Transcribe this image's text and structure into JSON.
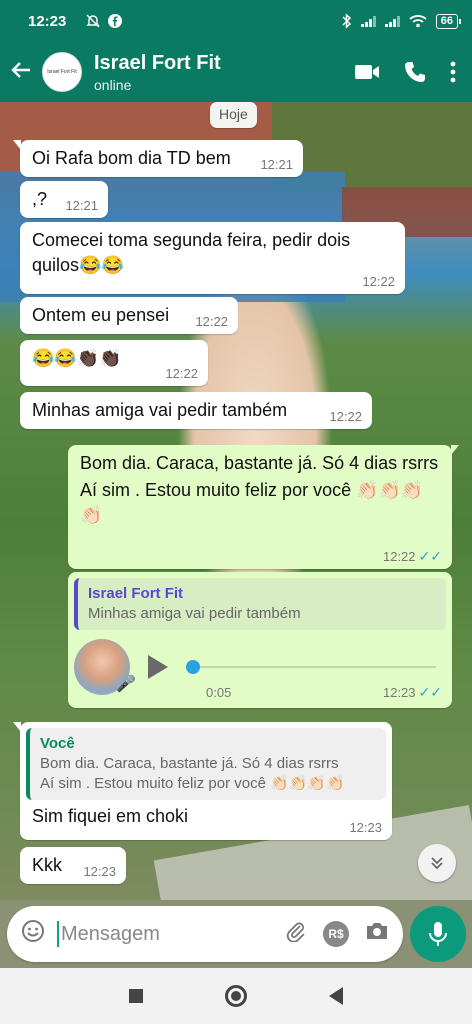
{
  "status_bar": {
    "time": "12:23",
    "battery": "66"
  },
  "header": {
    "contact_name": "Israel Fort Fit",
    "status": "online",
    "avatar_text": "Israel Fort Fit"
  },
  "chat": {
    "date_label": "Hoje",
    "messages": [
      {
        "direction": "in",
        "text": "Oi Rafa bom dia TD bem",
        "time": "12:21"
      },
      {
        "direction": "in",
        "text": ",?",
        "time": "12:21"
      },
      {
        "direction": "in",
        "text": "Comecei toma segunda feira, pedir dois quilos😂😂",
        "time": "12:22"
      },
      {
        "direction": "in",
        "text": "Ontem eu pensei",
        "time": "12:22"
      },
      {
        "direction": "in",
        "text": "😂😂👏🏿👏🏿",
        "time": "12:22"
      },
      {
        "direction": "in",
        "text": "Minhas amiga vai pedir também",
        "time": "12:22"
      },
      {
        "direction": "out",
        "text_line1": "Bom dia. Caraca, bastante já.  Só 4 dias rsrrs",
        "text_line2": "Aí sim . Estou muito feliz por você 👏🏻👏🏻👏🏻👏🏻",
        "time": "12:22",
        "read": true
      },
      {
        "direction": "out",
        "type": "voice",
        "quote_name": "Israel Fort Fit",
        "quote_text": "Minhas amiga vai pedir também",
        "duration": "0:05",
        "progress": 0,
        "time": "12:23",
        "read": true
      },
      {
        "direction": "in",
        "quote_name": "Você",
        "quote_line1": "Bom dia. Caraca, bastante já.  Só 4 dias rsrrs",
        "quote_line2": "Aí sim . Estou muito feliz por você 👏🏻👏🏻👏🏻👏🏻",
        "text": "Sim fiquei em choki",
        "time": "12:23"
      },
      {
        "direction": "in",
        "text": "Kkk",
        "time": "12:23"
      }
    ]
  },
  "composer": {
    "placeholder": "Mensagem",
    "currency_label": "R$"
  },
  "colors": {
    "header": "#0b7a63",
    "outgoing_bubble": "#e2fcc6",
    "read_ticks": "#35a2e0",
    "mic_button": "#0b9a7c"
  },
  "icons": [
    "back-arrow-icon",
    "video-call-icon",
    "phone-icon",
    "more-options-icon",
    "emoji-icon",
    "attach-icon",
    "payment-icon",
    "camera-icon",
    "mic-icon",
    "play-icon",
    "scroll-down-icon"
  ]
}
